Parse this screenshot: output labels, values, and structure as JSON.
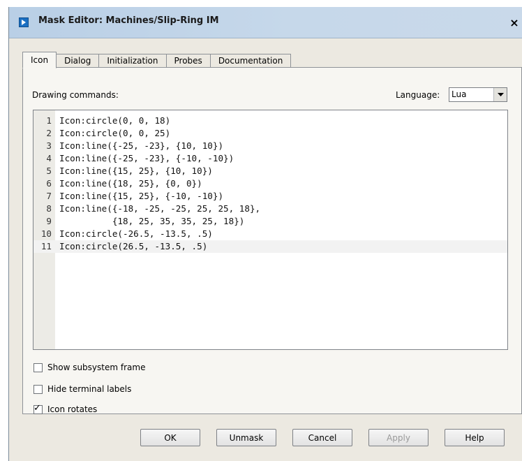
{
  "window": {
    "title": "Mask Editor: Machines/Slip-Ring IM",
    "close_label": "×"
  },
  "tabs": [
    {
      "label": "Icon",
      "active": true
    },
    {
      "label": "Dialog",
      "active": false
    },
    {
      "label": "Initialization",
      "active": false
    },
    {
      "label": "Probes",
      "active": false
    },
    {
      "label": "Documentation",
      "active": false
    }
  ],
  "editor": {
    "label": "Drawing commands:",
    "language_label": "Language:",
    "language_value": "Lua",
    "lines": [
      {
        "num": "1",
        "text": "Icon:circle(0, 0, 18)"
      },
      {
        "num": "2",
        "text": "Icon:circle(0, 0, 25)"
      },
      {
        "num": "3",
        "text": "Icon:line({-25, -23}, {10, 10})"
      },
      {
        "num": "4",
        "text": "Icon:line({-25, -23}, {-10, -10})"
      },
      {
        "num": "5",
        "text": "Icon:line({15, 25}, {10, 10})"
      },
      {
        "num": "6",
        "text": "Icon:line({18, 25}, {0, 0})"
      },
      {
        "num": "7",
        "text": "Icon:line({15, 25}, {-10, -10})"
      },
      {
        "num": "8",
        "text": "Icon:line({-18, -25, -25, 25, 25, 18},"
      },
      {
        "num": "9",
        "text": "          {18, 25, 35, 35, 25, 18})"
      },
      {
        "num": "10",
        "text": "Icon:circle(-26.5, -13.5, .5)"
      },
      {
        "num": "11",
        "text": "Icon:circle(26.5, -13.5, .5)"
      }
    ]
  },
  "options": [
    {
      "label": "Show subsystem frame",
      "checked": false
    },
    {
      "label": "Hide terminal labels",
      "checked": false
    },
    {
      "label": "Icon rotates",
      "checked": true
    }
  ],
  "buttons": {
    "ok": "OK",
    "unmask": "Unmask",
    "cancel": "Cancel",
    "apply": "Apply",
    "help": "Help"
  }
}
